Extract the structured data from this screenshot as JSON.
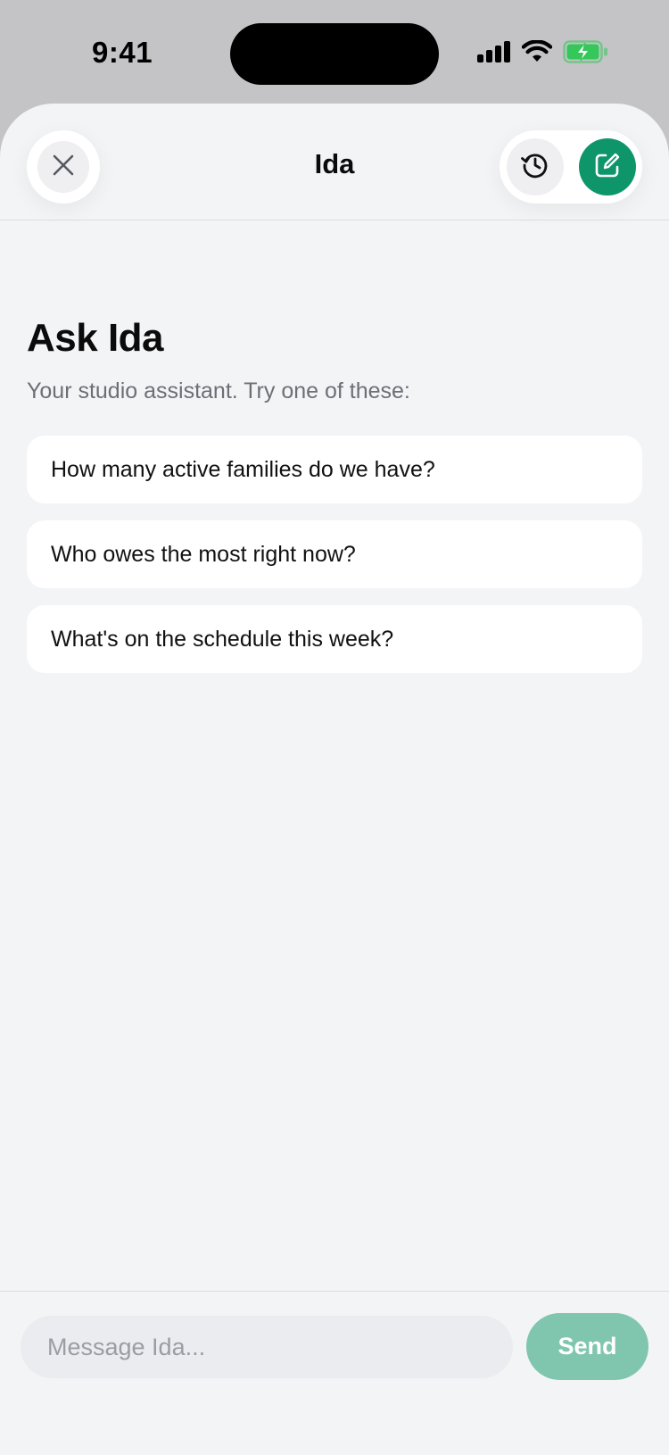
{
  "status_bar": {
    "time": "9:41"
  },
  "header": {
    "title": "Ida",
    "close_icon": "close-icon",
    "history_icon": "history-icon",
    "new_chat_icon": "compose-icon"
  },
  "intro": {
    "title": "Ask Ida",
    "subtitle": "Your studio assistant. Try one of these:"
  },
  "suggestions": [
    "How many active families do we have?",
    "Who owes the most right now?",
    "What's on the schedule this week?"
  ],
  "composer": {
    "placeholder": "Message Ida...",
    "value": "",
    "send_label": "Send"
  },
  "colors": {
    "accent": "#0e966a",
    "send_disabled": "#80c6af",
    "battery": "#34c759",
    "background": "#f3f4f6"
  }
}
